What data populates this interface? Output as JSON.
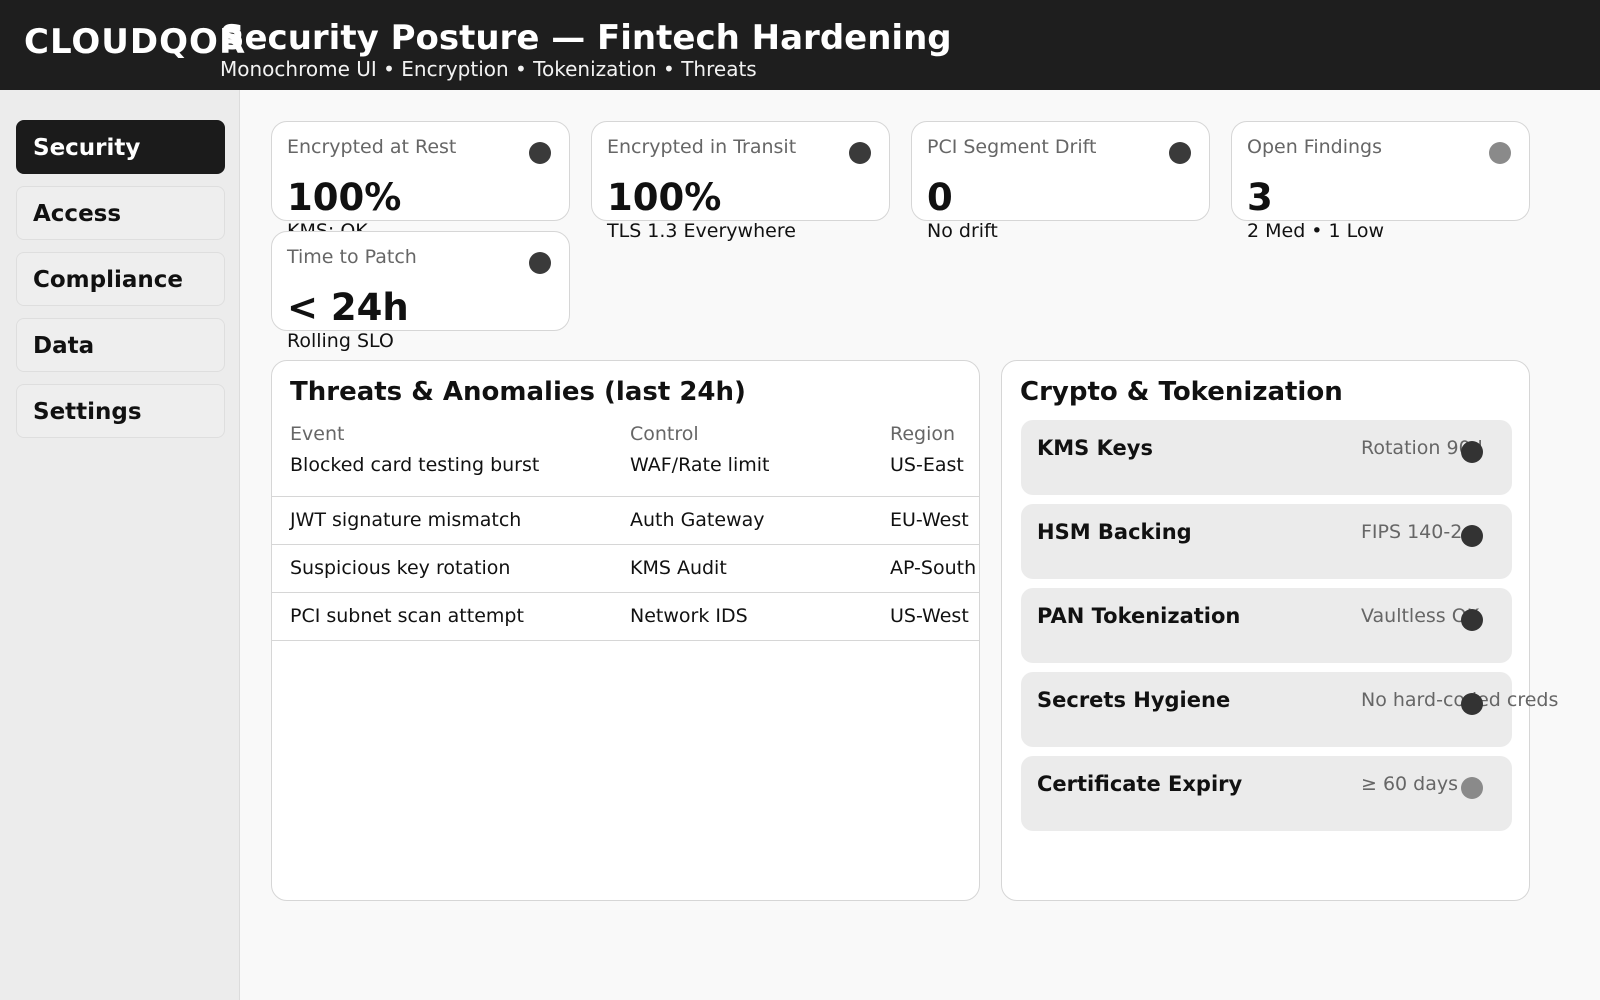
{
  "header": {
    "brand": "CLOUDQOR",
    "title": "Security Posture — Fintech Hardening",
    "subtitle": "Monochrome UI • Encryption • Tokenization • Threats"
  },
  "sidebar": {
    "items": [
      {
        "label": "Security",
        "active": true
      },
      {
        "label": "Access",
        "active": false
      },
      {
        "label": "Compliance",
        "active": false
      },
      {
        "label": "Data",
        "active": false
      },
      {
        "label": "Settings",
        "active": false
      }
    ]
  },
  "kpis": [
    {
      "label": "Encrypted at Rest",
      "value": "100%",
      "sub": "KMS: OK",
      "status": "dark"
    },
    {
      "label": "Encrypted in Transit",
      "value": "100%",
      "sub": "TLS 1.3 Everywhere",
      "status": "dark"
    },
    {
      "label": "PCI Segment Drift",
      "value": "0",
      "sub": "No drift",
      "status": "dark"
    },
    {
      "label": "Open Findings",
      "value": "3",
      "sub": "2 Med • 1 Low",
      "status": "light"
    },
    {
      "label": "Time to Patch",
      "value": "< 24h",
      "sub": "Rolling SLO",
      "status": "dark"
    }
  ],
  "threats": {
    "title": "Threats & Anomalies (last 24h)",
    "columns": [
      "Event",
      "Control",
      "Region"
    ],
    "rows": [
      [
        "Blocked card testing burst",
        "WAF/Rate limit",
        "US-East"
      ],
      [
        "JWT signature mismatch",
        "Auth Gateway",
        "EU-West"
      ],
      [
        "Suspicious key rotation",
        "KMS Audit",
        "AP-South"
      ],
      [
        "PCI subnet scan attempt",
        "Network IDS",
        "US-West"
      ]
    ]
  },
  "crypto": {
    "title": "Crypto & Tokenization",
    "items": [
      {
        "name": "KMS Keys",
        "status": "Rotation 90d",
        "level": "dark"
      },
      {
        "name": "HSM Backing",
        "status": "FIPS 140-2",
        "level": "dark"
      },
      {
        "name": "PAN Tokenization",
        "status": "Vaultless OK",
        "level": "dark"
      },
      {
        "name": "Secrets Hygiene",
        "status": "No hard-coded creds",
        "level": "dark"
      },
      {
        "name": "Certificate Expiry",
        "status": "≥ 60 days",
        "level": "light"
      }
    ]
  }
}
